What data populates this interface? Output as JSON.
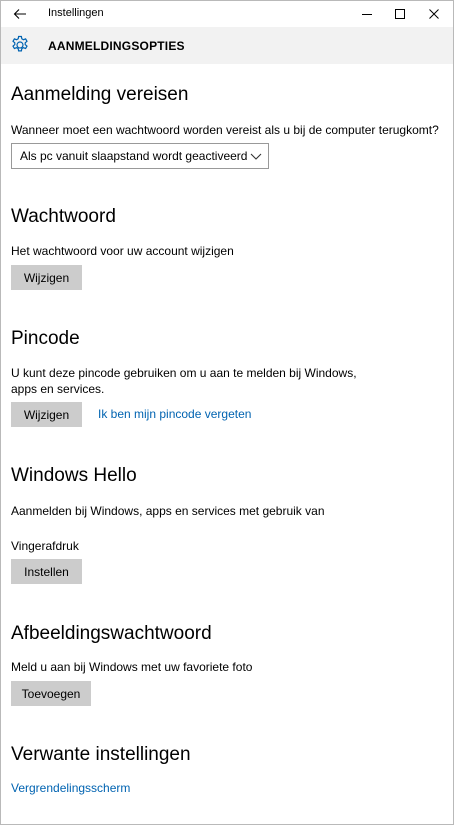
{
  "titlebar": {
    "title": "Instellingen",
    "back_icon": "back-arrow-icon",
    "minimize_icon": "minimize-icon",
    "maximize_icon": "maximize-icon",
    "close_icon": "close-icon"
  },
  "header": {
    "icon": "gear-icon",
    "title": "AANMELDINGSOPTIES"
  },
  "sections": {
    "sign_in_required": {
      "title": "Aanmelding vereisen",
      "description": "Wanneer moet een wachtwoord worden vereist als u bij de computer terugkomt?",
      "dropdown_value": "Als pc vanuit slaapstand wordt geactiveerd"
    },
    "password": {
      "title": "Wachtwoord",
      "description": "Het wachtwoord voor uw account wijzigen",
      "button_label": "Wijzigen"
    },
    "pin": {
      "title": "Pincode",
      "description_line1": "U kunt deze pincode gebruiken om u aan te melden bij Windows,",
      "description_line2": "apps en services.",
      "button_label": "Wijzigen",
      "forgot_link": "Ik ben mijn pincode vergeten"
    },
    "windows_hello": {
      "title": "Windows Hello",
      "description": "Aanmelden bij Windows, apps en services met gebruik van",
      "fingerprint_label": "Vingerafdruk",
      "button_label": "Instellen"
    },
    "picture_password": {
      "title": "Afbeeldingswachtwoord",
      "description": "Meld u aan bij Windows met uw favoriete foto",
      "button_label": "Toevoegen"
    },
    "related": {
      "title": "Verwante instellingen",
      "lock_screen_link": "Vergrendelingsscherm"
    }
  },
  "colors": {
    "accent": "#0063b1",
    "header_bg": "#f2f2f2",
    "button_bg": "#cccccc",
    "window_border": "#b9b9b9"
  }
}
